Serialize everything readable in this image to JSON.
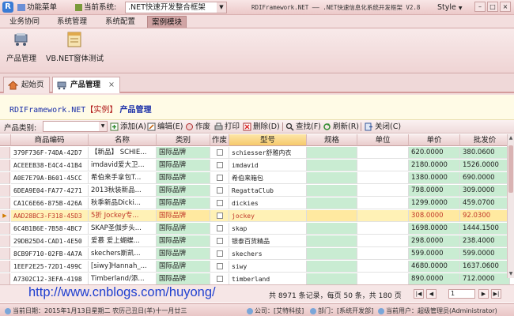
{
  "titlebar": {
    "logo": "R",
    "menu_label": "功能菜单",
    "system_label": "当前系统:",
    "system_value": ".NET快速开发整合框架",
    "app_title": "RDIFramework.NET  ——  .NET快速信息化系统开发框架 V2.8",
    "style_label": "Style",
    "min": "–",
    "max": "□",
    "close": "×"
  },
  "ribbon": {
    "tabs": [
      "业务协同",
      "系统管理",
      "系统配置",
      "案例模块"
    ],
    "active_tab": 3,
    "buttons": [
      "产品管理",
      "VB.NET窗体测试"
    ]
  },
  "doc_tabs": [
    {
      "label": "起始页",
      "close": ""
    },
    {
      "label": "产品管理",
      "close": "×"
    }
  ],
  "heading": {
    "brand": "RDIFramework.NET",
    "bracket": "【实例】",
    "title": "产品管理"
  },
  "toolbar": {
    "category_label": "产品类别:",
    "category_value": "",
    "buttons": [
      "添加(A)",
      "编辑(E)",
      "作废",
      "打印",
      "删除(D)",
      "查找(F)",
      "刷新(R)",
      "关闭(C)"
    ]
  },
  "grid": {
    "columns": [
      "商品编码",
      "名称",
      "类别",
      "作废",
      "型号",
      "规格",
      "单位",
      "单价",
      "批发价"
    ],
    "selected_column": 4,
    "current_row": 6,
    "rows": [
      [
        "379F736F-74DA-42D7",
        "【新品】 SCHIE...",
        "国际品牌",
        "",
        "schiesser舒雅内衣",
        "",
        "",
        "620.0000",
        "380.0600"
      ],
      [
        "ACEEEB38-E4C4-41B4",
        "imdavid爱大卫...",
        "国际品牌",
        "",
        "imdavid",
        "",
        "",
        "2180.0000",
        "1526.0000"
      ],
      [
        "A0E7E79A-B601-45CC",
        "希伯来手拿包T...",
        "国际品牌",
        "",
        "希伯来箱包",
        "",
        "",
        "1380.0000",
        "690.0000"
      ],
      [
        "6DEA9E04-FA77-4271",
        "2013秋装新品...",
        "国际品牌",
        "",
        "RegattaClub",
        "",
        "",
        "798.0000",
        "309.0000"
      ],
      [
        "CA1C6E66-875B-426A",
        "秋季新品Dicki...",
        "国际品牌",
        "",
        "dickies",
        "",
        "",
        "1299.0000",
        "459.0700"
      ],
      [
        "AAD28BC3-F318-45D3",
        "5折 Jockey专...",
        "国际品牌",
        "",
        "jockey",
        "",
        "",
        "308.0000",
        "92.0300"
      ],
      [
        "6C4B1B6E-7B58-4BC7",
        "SKAP圣伽步头...",
        "国际品牌",
        "",
        "skap",
        "",
        "",
        "1698.0000",
        "1444.1500"
      ],
      [
        "29DB25D4-CAD1-4E50",
        "爱慕 爱上蝴蝶...",
        "国际品牌",
        "",
        "银泰百货精品",
        "",
        "",
        "298.0000",
        "238.4000"
      ],
      [
        "8CB9F710-02FB-4A7A",
        "skechers斯凯...",
        "国际品牌",
        "",
        "skechers",
        "",
        "",
        "599.0000",
        "599.0000"
      ],
      [
        "1EEF2E25-72D1-499C",
        "[siwy]Hannah_...",
        "国际品牌",
        "",
        "siwy",
        "",
        "",
        "4680.0000",
        "1637.0600"
      ],
      [
        "A7302C12-3EFA-4198",
        "Timberland/添...",
        "国际品牌",
        "",
        "timberland",
        "",
        "",
        "890.0000",
        "712.0000"
      ]
    ]
  },
  "pager": {
    "url": "http://www.cnblogs.com/huyong/",
    "info": "共 8971 条记录，每页 50 条，共 180 页",
    "page": "1",
    "first": "|◀",
    "prev": "◀",
    "next": "▶",
    "last": "▶|"
  },
  "status": {
    "date": "当前日期：2015年1月13日星期二 农历己丑日(羊)十一月廿三",
    "company": "公司：[艾特科技]",
    "department": "部门：[系统开发部]",
    "user": "当前用户：超级管理员(Administrator)"
  },
  "colors": {
    "accent": "#d0a4a4",
    "grid_green": "#c9ecd2",
    "current_row": "#fff1b6",
    "link": "#1f3fd0"
  }
}
